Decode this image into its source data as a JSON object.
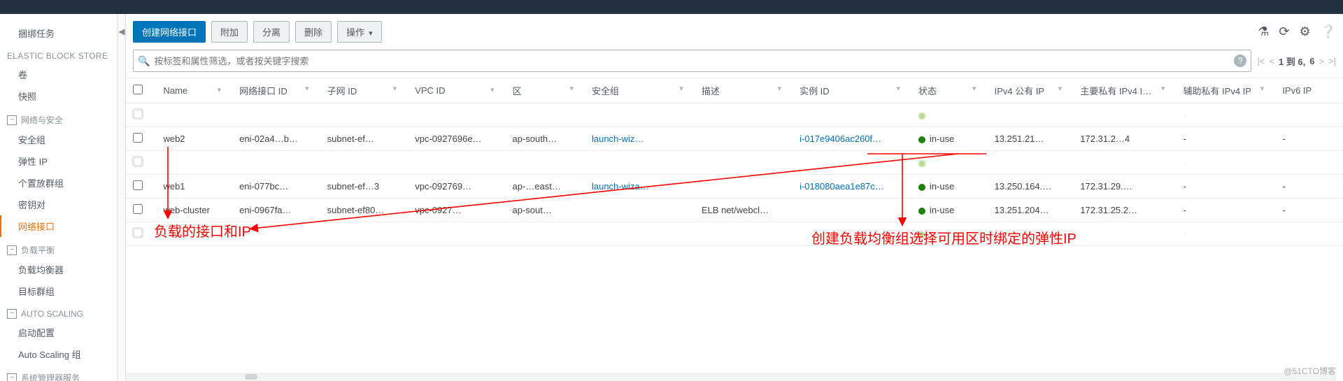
{
  "sidebar": {
    "items": [
      {
        "label": "捆绑任务"
      },
      {
        "heading": "ELASTIC BLOCK STORE"
      },
      {
        "label": "卷"
      },
      {
        "label": "快照"
      },
      {
        "group": "网络与安全"
      },
      {
        "label": "安全组"
      },
      {
        "label": "弹性 IP"
      },
      {
        "label": "个置放群组"
      },
      {
        "label": "密钥对"
      },
      {
        "label": "网络接口",
        "active": true
      },
      {
        "group": "负载平衡"
      },
      {
        "label": "负载均衡器"
      },
      {
        "label": "目标群组"
      },
      {
        "group": "AUTO SCALING"
      },
      {
        "label": "启动配置"
      },
      {
        "label": "Auto Scaling 组"
      },
      {
        "group": "系统管理器服务"
      }
    ]
  },
  "toolbar": {
    "create_label": "创建网络接口",
    "attach_label": "附加",
    "detach_label": "分离",
    "delete_label": "删除",
    "actions_label": "操作"
  },
  "search": {
    "placeholder": "按标签和属性筛选，或者按关键字搜索"
  },
  "pager": {
    "text": "1 到 6,",
    "total": "6"
  },
  "columns": {
    "name": "Name",
    "eni": "网络接口 ID",
    "subnet": "子网 ID",
    "vpc": "VPC ID",
    "az": "区",
    "sg": "安全组",
    "desc": "描述",
    "inst": "实例 ID",
    "state": "状态",
    "pub": "IPv4 公有 IP",
    "pri": "主要私有 IPv4 I…",
    "sec": "辅助私有 IPv4 IP",
    "v6": "IPv6 IP"
  },
  "rows": [
    {
      "blurred": true,
      "name": "",
      "eni": "",
      "subnet": "",
      "vpc": "",
      "az": "",
      "sg": "",
      "desc": "",
      "inst": "",
      "state": "",
      "pub": "",
      "pri": "",
      "sec": "-",
      "v6": ""
    },
    {
      "blurred": false,
      "name": "web2",
      "eni": "eni-02a4…b…",
      "subnet": "subnet-ef…",
      "vpc": "vpc-0927696e…",
      "az": "ap-south…",
      "sg": "launch-wiz…",
      "desc": "",
      "inst": "i-017e9406ac260f…",
      "state": "in-use",
      "pub": "13.251.21…",
      "pri": "172.31.2…4",
      "sec": "-",
      "v6": "-"
    },
    {
      "blurred": true,
      "name": "",
      "eni": "",
      "subnet": "",
      "vpc": "",
      "az": "",
      "sg": "",
      "desc": "",
      "inst": "",
      "state": "",
      "pub": "",
      "pri": "",
      "sec": "-",
      "v6": ""
    },
    {
      "blurred": false,
      "name": "web1",
      "eni": "eni-077bc…",
      "subnet": "subnet-ef…3",
      "vpc": "vpc-092769…",
      "az": "ap-…east…",
      "sg": "launch-wiza…",
      "desc": "",
      "inst": "i-018080aea1e87c…",
      "state": "in-use",
      "pub": "13.250.164.…",
      "pri": "172.31.29.…",
      "sec": "-",
      "v6": "-"
    },
    {
      "blurred": false,
      "name": "web-cluster",
      "eni": "eni-0967fa…",
      "subnet": "subnet-ef80…",
      "vpc": "vpc-0927…",
      "az": "ap-sout…",
      "sg": "",
      "desc": "ELB net/webcl…",
      "inst": "",
      "state": "in-use",
      "pub": "13.251.204…",
      "pri": "172.31.25.2…",
      "sec": "-",
      "v6": "-"
    },
    {
      "blurred": true,
      "name": "",
      "eni": "",
      "subnet": "",
      "vpc": "",
      "az": "",
      "sg": "",
      "desc": "",
      "inst": "",
      "state": "",
      "pub": "",
      "pri": "",
      "sec": "-",
      "v6": ""
    }
  ],
  "annotations": {
    "left_text": "负载的接口和IP",
    "right_text": "创建负载均衡组选择可用区时绑定的弹性IP",
    "watermark": "@51CTO博客"
  }
}
